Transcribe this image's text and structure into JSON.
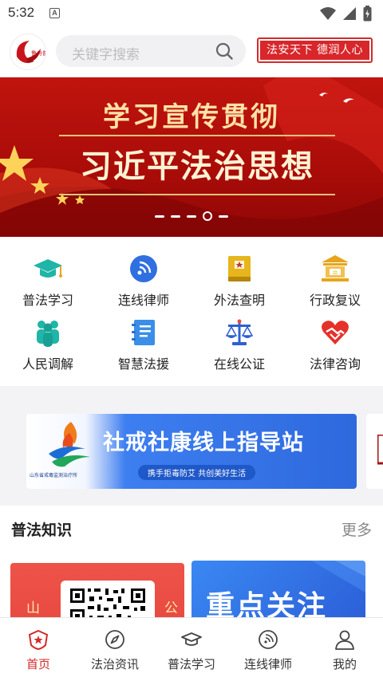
{
  "status_bar": {
    "time": "5:32",
    "notification_letter": "A"
  },
  "header": {
    "search_placeholder": "关键字搜索",
    "slogan": "法安天下 德润人心",
    "logo_text": "鲁舟普法"
  },
  "banner": {
    "line1": "学习宣传贯彻",
    "line2": "习近平法治思想",
    "slide_count": 5,
    "active_slide": 4
  },
  "services": [
    {
      "label": "普法学习",
      "icon": "graduation-cap-icon"
    },
    {
      "label": "连线律师",
      "icon": "call-signal-icon"
    },
    {
      "label": "外法查明",
      "icon": "law-book-icon"
    },
    {
      "label": "行政复议",
      "icon": "government-building-icon"
    },
    {
      "label": "人民调解",
      "icon": "people-group-icon"
    },
    {
      "label": "智慧法援",
      "icon": "notebook-icon"
    },
    {
      "label": "在线公证",
      "icon": "scales-icon"
    },
    {
      "label": "法律咨询",
      "icon": "heart-handshake-icon"
    }
  ],
  "ad": {
    "title": "社戒社康线上指导站",
    "subtitle": "携手拒毒防艾  共创美好生活",
    "org": "山东省戒毒监测治疗所"
  },
  "section": {
    "title": "普法知识",
    "more": "更多"
  },
  "cards": {
    "card1_left": "山",
    "card1_right": "公",
    "card2_text": "重点关注"
  },
  "tabbar": [
    {
      "label": "首页",
      "icon": "home-shield-icon",
      "active": true
    },
    {
      "label": "法治资讯",
      "icon": "compass-icon",
      "active": false
    },
    {
      "label": "普法学习",
      "icon": "graduation-cap-icon",
      "active": false
    },
    {
      "label": "连线律师",
      "icon": "call-signal-icon",
      "active": false
    },
    {
      "label": "我的",
      "icon": "user-icon",
      "active": false
    }
  ],
  "colors": {
    "brand_red": "#d42a2a",
    "banner_red": "#b50f0b",
    "teal": "#1fb5a7",
    "blue": "#2f6fe0",
    "gold": "#e7a51c"
  }
}
